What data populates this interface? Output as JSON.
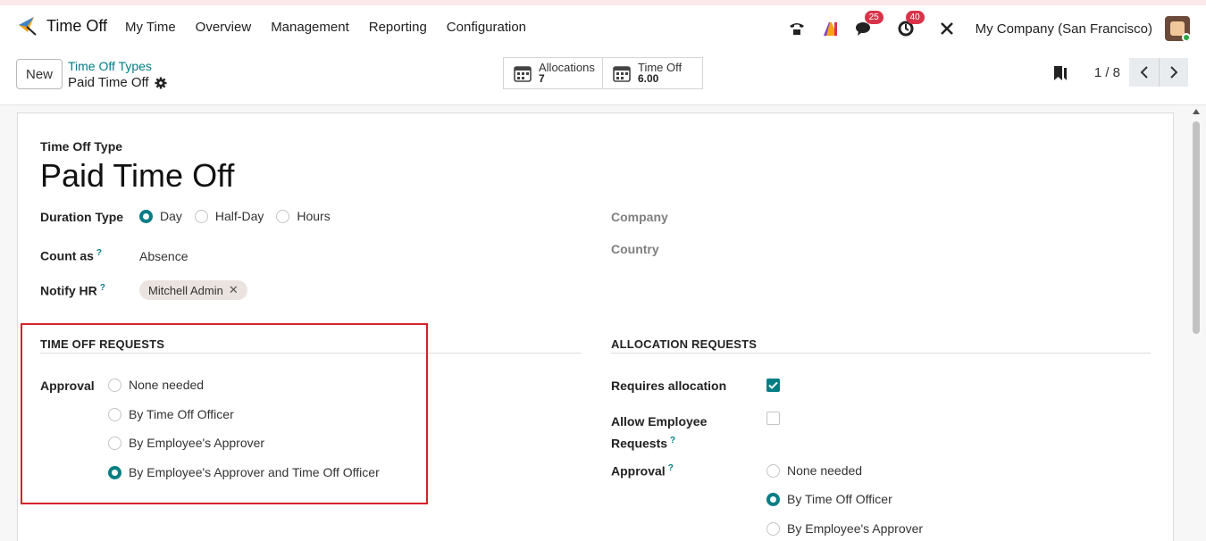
{
  "nav": {
    "app_name": "Time Off",
    "menu": [
      "My Time",
      "Overview",
      "Management",
      "Reporting",
      "Configuration"
    ],
    "messages_count": "25",
    "activities_count": "40",
    "company": "My Company (San Francisco)"
  },
  "control": {
    "new_label": "New",
    "breadcrumb_parent": "Time Off Types",
    "breadcrumb_current": "Paid Time Off",
    "smart_buttons": [
      {
        "label": "Allocations",
        "value": "7"
      },
      {
        "label": "Time Off",
        "value": "6.00"
      }
    ],
    "pager": "1 / 8"
  },
  "form": {
    "type_label": "Time Off Type",
    "name": "Paid Time Off",
    "duration_label": "Duration Type",
    "duration_options": [
      "Day",
      "Half-Day",
      "Hours"
    ],
    "duration_selected": "Day",
    "count_as_label": "Count as",
    "count_as_value": "Absence",
    "notify_label": "Notify HR",
    "notify_tag": "Mitchell Admin",
    "company_label": "Company",
    "country_label": "Country",
    "help_mark": "?"
  },
  "time_off_requests": {
    "title": "TIME OFF REQUESTS",
    "approval_label": "Approval",
    "options": [
      "None needed",
      "By Time Off Officer",
      "By Employee's Approver",
      "By Employee's Approver and Time Off Officer"
    ],
    "selected": "By Employee's Approver and Time Off Officer"
  },
  "allocation_requests": {
    "title": "ALLOCATION REQUESTS",
    "requires_label": "Requires allocation",
    "requires_checked": true,
    "allow_label_1": "Allow Employee",
    "allow_label_2": "Requests",
    "allow_checked": false,
    "approval_label": "Approval",
    "options": [
      "None needed",
      "By Time Off Officer",
      "By Employee's Approver"
    ],
    "selected": "By Time Off Officer"
  },
  "colors": {
    "accent": "#017e84",
    "highlight": "#d4232a"
  }
}
